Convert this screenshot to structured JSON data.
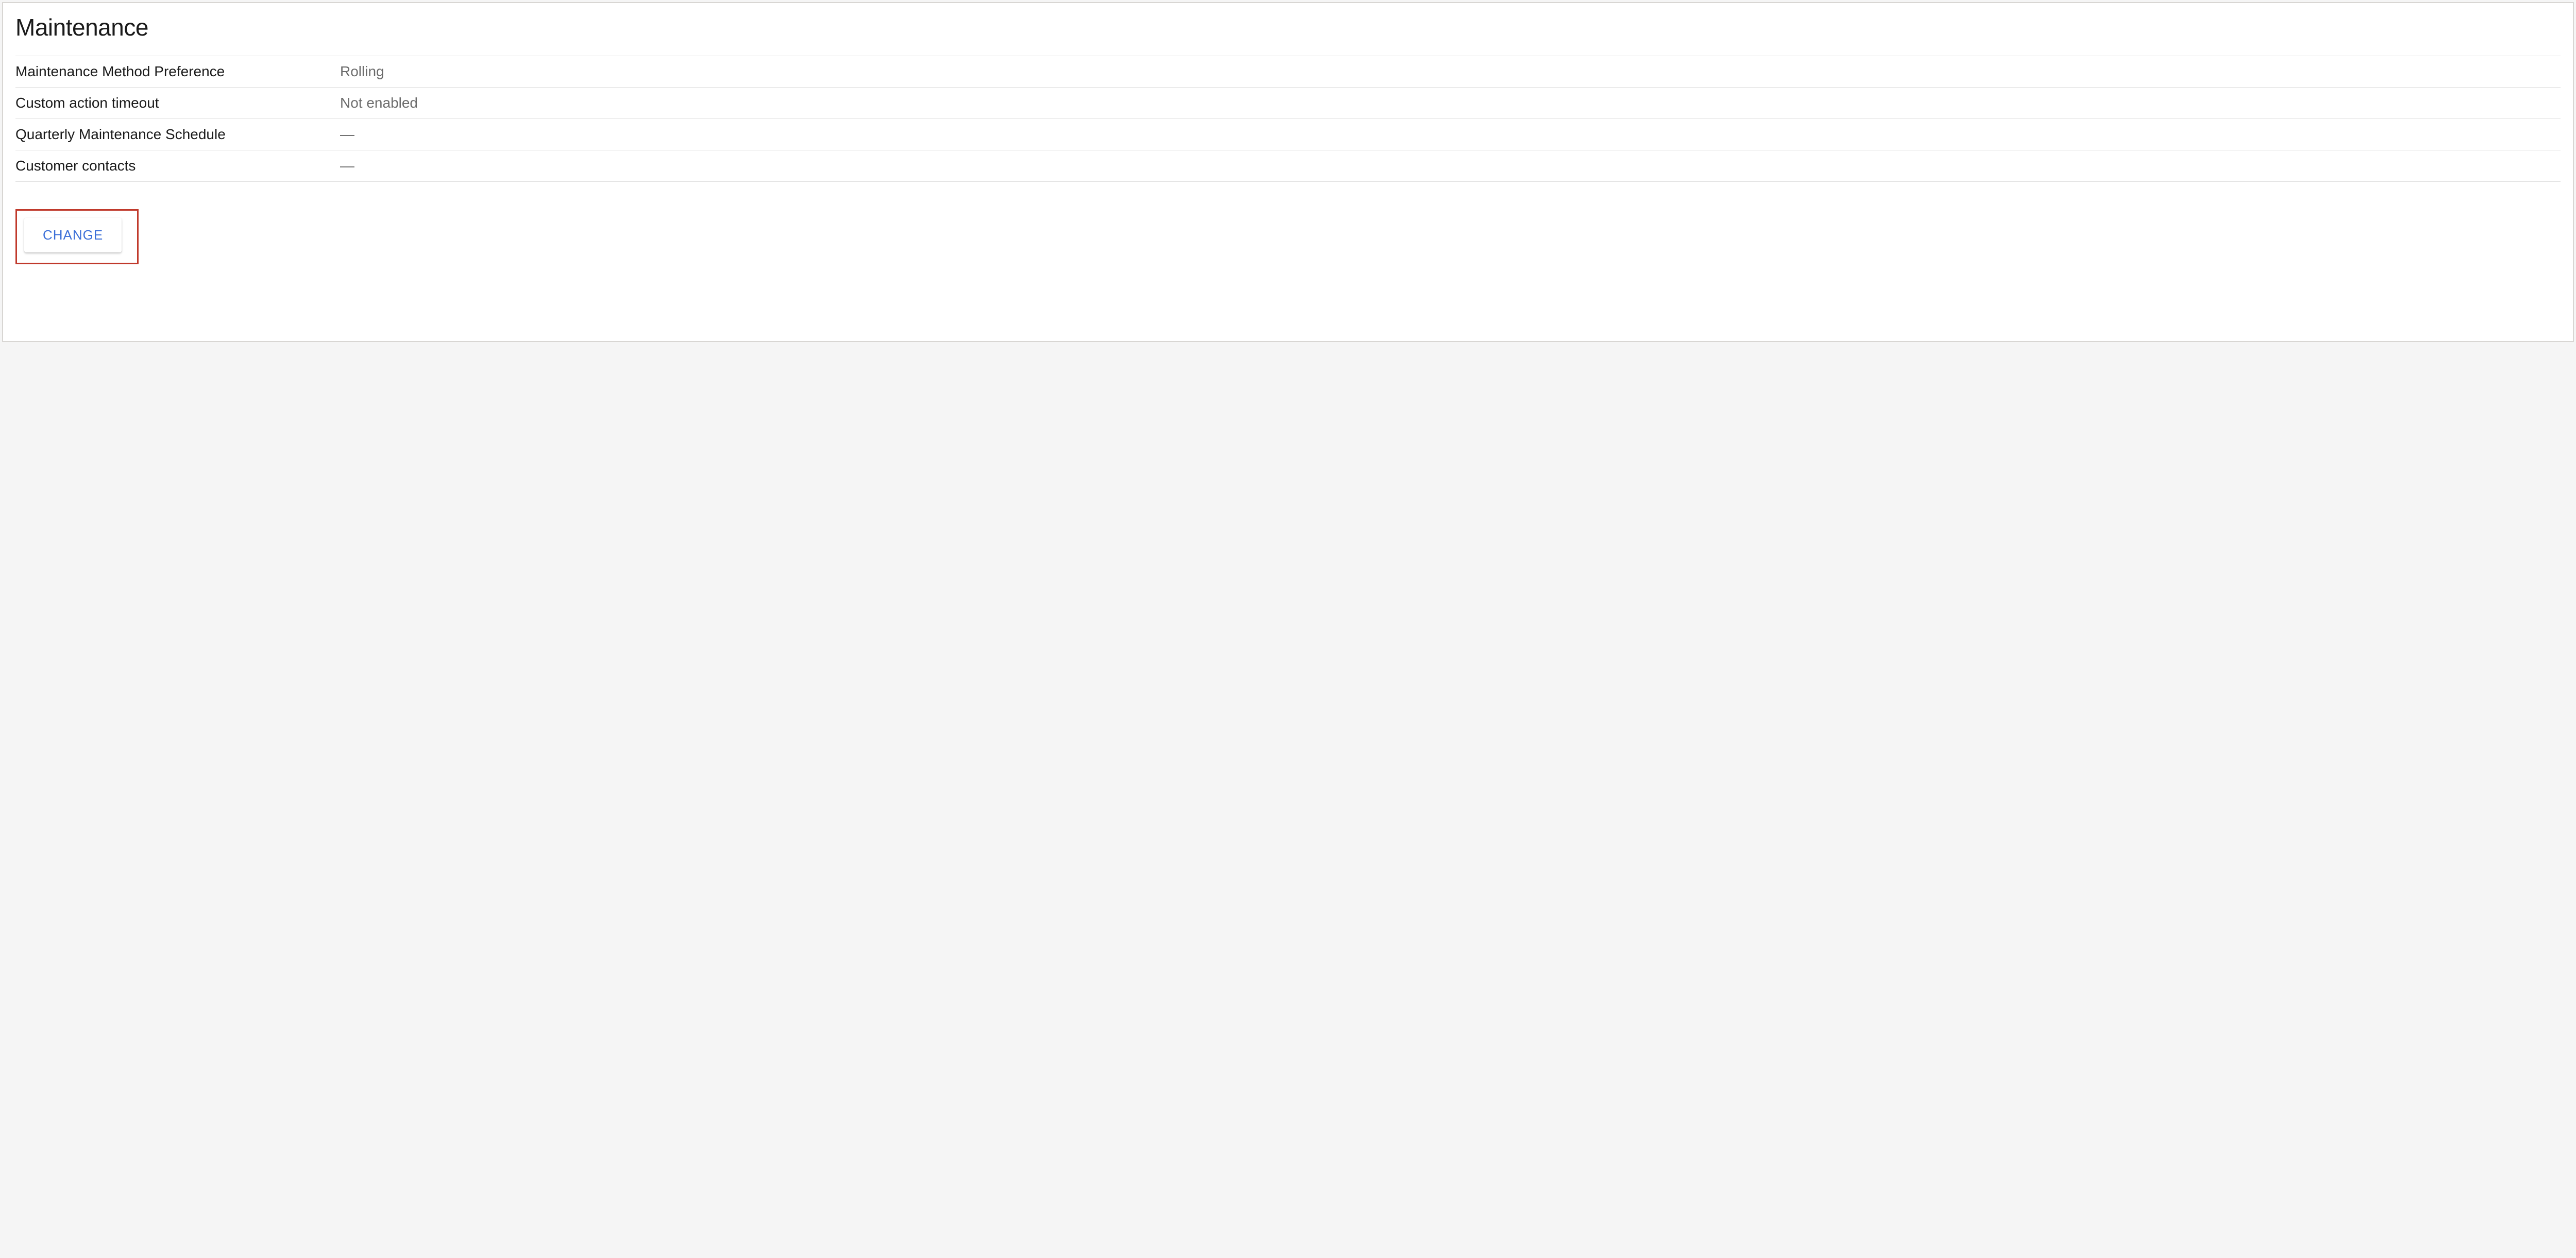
{
  "section": {
    "title": "Maintenance",
    "rows": [
      {
        "label": "Maintenance Method Preference",
        "value": "Rolling"
      },
      {
        "label": "Custom action timeout",
        "value": "Not enabled"
      },
      {
        "label": "Quarterly Maintenance Schedule",
        "value": "—"
      },
      {
        "label": "Customer contacts",
        "value": "—"
      }
    ],
    "change_button_label": "CHANGE"
  }
}
